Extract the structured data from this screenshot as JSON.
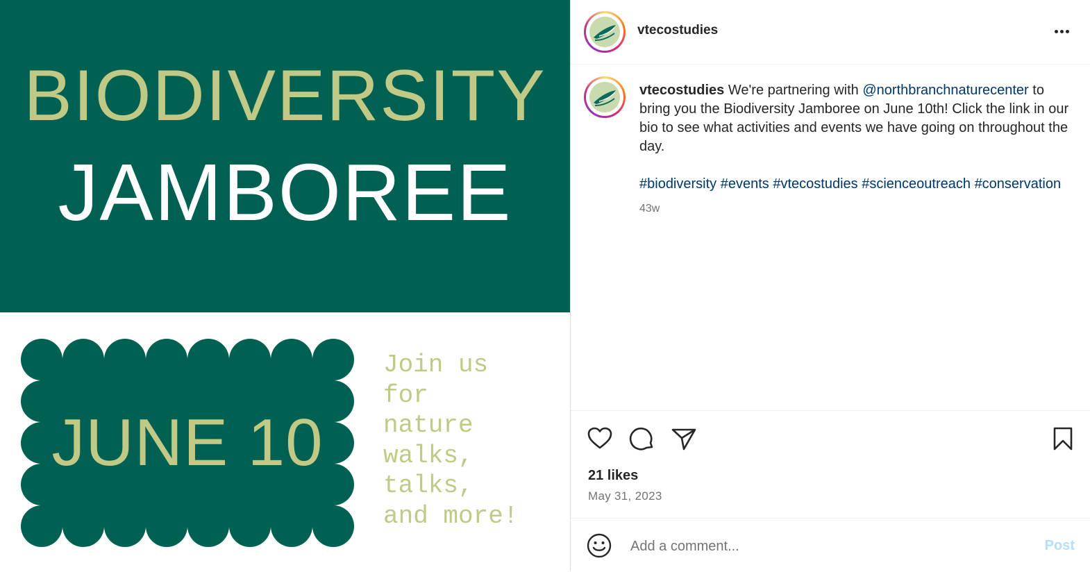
{
  "poster": {
    "title_line1": "BIODIVERSITY",
    "title_line2": "JAMBOREE",
    "date": "JUNE 10",
    "tagline": "Join us\nfor\nnature\nwalks,\ntalks,\nand more!",
    "colors": {
      "green": "#006152",
      "sage": "#c1c987",
      "white": "#ffffff"
    }
  },
  "header": {
    "username": "vtecostudies",
    "avatar_icon": "bird-logo-icon",
    "more_icon": "more-options-icon"
  },
  "caption": {
    "username": "vtecostudies",
    "text_before_mention": " We're partnering with ",
    "mention": "@northbranchnaturecenter",
    "text_after_mention": " to bring you the Biodiversity Jamboree on June 10th! Click the link in our bio to see what activities and events we have going on throughout the day.",
    "hashtags": [
      "#biodiversity",
      "#events",
      "#vtecostudies",
      "#scienceoutreach",
      "#conservation"
    ],
    "age": "43w"
  },
  "actions": {
    "like_icon": "heart-icon",
    "comment_icon": "comment-icon",
    "share_icon": "share-icon",
    "save_icon": "bookmark-icon"
  },
  "stats": {
    "likes": "21 likes",
    "date": "May 31, 2023"
  },
  "comment": {
    "emoji_icon": "emoji-icon",
    "placeholder": "Add a comment...",
    "post_label": "Post"
  }
}
